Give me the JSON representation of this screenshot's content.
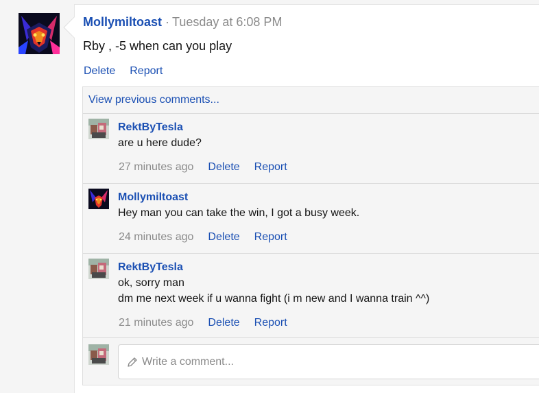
{
  "message": {
    "author": "Mollymiltoast",
    "separator": "·",
    "time": "Tuesday at 6:08 PM",
    "body": "Rby , -5 when can you play",
    "actions": {
      "delete": "Delete",
      "report": "Report"
    }
  },
  "comments": {
    "view_previous": "View previous comments...",
    "items": [
      {
        "author": "RektByTesla",
        "lines": [
          "are u here dude?"
        ],
        "time": "27 minutes ago",
        "delete": "Delete",
        "report": "Report"
      },
      {
        "author": "Mollymiltoast",
        "lines": [
          "Hey man you can take the win, I got a busy week."
        ],
        "time": "24 minutes ago",
        "delete": "Delete",
        "report": "Report"
      },
      {
        "author": "RektByTesla",
        "lines": [
          "ok, sorry man",
          "dm me next week if u wanna fight (i m new and I wanna train ^^)"
        ],
        "time": "21 minutes ago",
        "delete": "Delete",
        "report": "Report"
      }
    ],
    "write_placeholder": "Write a comment..."
  },
  "icons": {
    "pencil": "pencil-icon"
  }
}
